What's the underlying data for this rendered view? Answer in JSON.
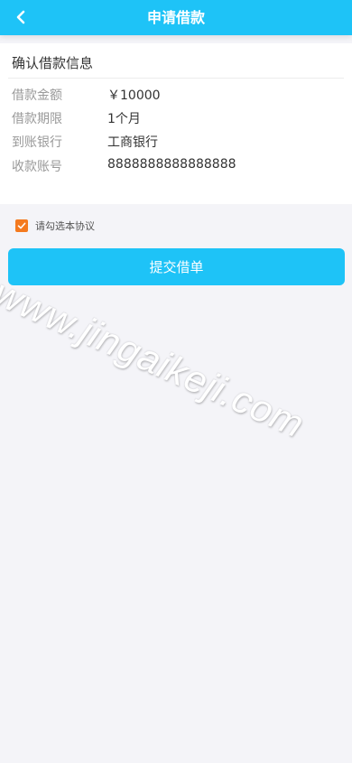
{
  "header": {
    "title": "申请借款",
    "back_icon": "chevron-left-icon"
  },
  "card": {
    "title": "确认借款信息",
    "rows": [
      {
        "label": "借款金额",
        "value": "￥10000"
      },
      {
        "label": "借款期限",
        "value": "1个月"
      },
      {
        "label": "到账银行",
        "value": "工商银行"
      },
      {
        "label": "收款账号",
        "value": "8888888888888888"
      }
    ]
  },
  "agreement": {
    "text": "请勾选本协议",
    "checked": true,
    "checkbox_color": "#f47a1f"
  },
  "submit": {
    "label": "提交借单"
  },
  "watermark": {
    "text": "www.jingaikeji.com"
  },
  "colors": {
    "primary": "#1ec3f7",
    "background": "#f4f4f8",
    "accent": "#f47a1f"
  }
}
